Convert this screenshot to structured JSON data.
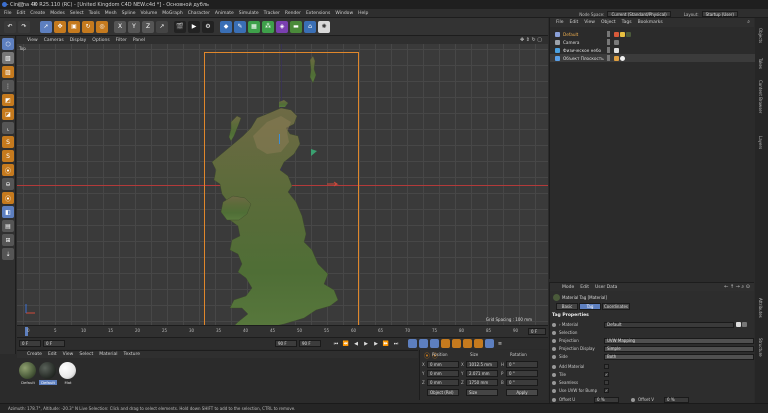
{
  "window": {
    "title": "Cinema 4D R25.110 (RC) - [United Kingdom C4D NEW.c4d *] - Основной дубль",
    "controls": [
      "–",
      "□",
      "✕"
    ]
  },
  "menubar": {
    "items": [
      "File",
      "Edit",
      "Create",
      "Modes",
      "Select",
      "Tools",
      "Mesh",
      "Spline",
      "Volume",
      "MoGraph",
      "Character",
      "Animate",
      "Simulate",
      "Tracker",
      "Render",
      "Extensions",
      "Window",
      "Help"
    ],
    "node_space_label": "Node Space:",
    "node_space_value": "Current (Standard/Physical)",
    "layout_label": "Layout:",
    "layout_value": "Startup (User)"
  },
  "viewport": {
    "menu": [
      "View",
      "Cameras",
      "Display",
      "Options",
      "Filter",
      "Panel"
    ],
    "label": "Top",
    "grid_spacing": "Grid Spacing : 100 mm",
    "colors": {
      "plane_border": "#e0872b",
      "x_axis": "#b33a3a"
    }
  },
  "timeline": {
    "ticks": [
      "0",
      "5",
      "10",
      "15",
      "20",
      "25",
      "30",
      "35",
      "40",
      "45",
      "50",
      "55",
      "60",
      "65",
      "70",
      "75",
      "80",
      "85",
      "90"
    ],
    "current_frame": "0 F",
    "start_field": "0 F",
    "start_field2": "0 F",
    "end_field": "90 F",
    "end_field2": "90 F"
  },
  "material_manager": {
    "menu": [
      "Create",
      "Edit",
      "View",
      "Select",
      "Material",
      "Texture"
    ],
    "materials": [
      {
        "label": "Default",
        "color": "#4a5a3a"
      },
      {
        "label": "Default",
        "color": "#2a2f2a",
        "selected": true
      },
      {
        "label": "Mat",
        "color": "#e9e9e9"
      }
    ]
  },
  "coordinates": {
    "headers": {
      "position": "Position",
      "size": "Size",
      "rotation": "Rotation"
    },
    "rows": [
      {
        "axis": "X",
        "pos": "0 mm",
        "size": "1012.5 mm",
        "rot_axis": "H",
        "rot": "0 °"
      },
      {
        "axis": "Y",
        "pos": "0 mm",
        "size": "2.071 mm",
        "rot_axis": "P",
        "rot": "0 °"
      },
      {
        "axis": "Z",
        "pos": "0 mm",
        "size": "1750 mm",
        "rot_axis": "B",
        "rot": "0 °"
      }
    ],
    "mode_dropdown": "Object (Rel)",
    "size_dropdown": "Size",
    "apply_label": "Apply"
  },
  "object_manager": {
    "menu": [
      "File",
      "Edit",
      "View",
      "Object",
      "Tags",
      "Bookmarks"
    ],
    "objects": [
      {
        "name": "Default",
        "icon_color": "#8aa0d8",
        "tag_colors": [
          "#d85a3a",
          "#e8c040",
          "#4a5a3a"
        ]
      },
      {
        "name": "Camera",
        "icon_color": "#9aa0a8",
        "tag_colors": [
          "#7a7a7a"
        ]
      },
      {
        "name": "Физическое небо",
        "icon_color": "#4aa0e0",
        "tag_colors": [
          "#e0e0e0"
        ]
      },
      {
        "name": "Объект Плоскость",
        "icon_color": "#5aa0e8",
        "tag_colors": [
          "#e0a040",
          "#f0f0f0"
        ]
      }
    ]
  },
  "attribute_manager": {
    "menu": [
      "Mode",
      "Edit",
      "User Data"
    ],
    "tag_title": "Material Tag [Material]",
    "tabs": [
      "Basic",
      "Tag",
      "Coordinates"
    ],
    "section": "Tag Properties",
    "rows": [
      {
        "label": "› Material",
        "value": "Default"
      },
      {
        "label": "Selection",
        "value": ""
      },
      {
        "label": "Projection",
        "value": "UVW Mapping"
      },
      {
        "label": "Projection Display",
        "value": "Simple"
      },
      {
        "label": "Side",
        "value": "Both"
      },
      {
        "label": "Add Material",
        "value": "",
        "checkbox": true,
        "checked": false
      },
      {
        "label": "Tile",
        "value": "",
        "checkbox": true,
        "checked": true
      },
      {
        "label": "Seamless",
        "value": "",
        "checkbox": true,
        "checked": false
      },
      {
        "label": "Use UVW for Bump",
        "value": "",
        "checkbox": true,
        "checked": true
      }
    ],
    "offset_u_label": "Offset U",
    "offset_u": "0 %",
    "offset_v_label": "Offset V",
    "offset_v": "0 %"
  },
  "right_tabs": [
    "Objects",
    "Takes",
    "Content Browser",
    "Layers",
    "Attributes",
    "Structure"
  ],
  "status": {
    "text": "Azimuth: 178.7°, Altitude: -20.3° N    Live Selection: Click and drag to select elements. Hold down SHIFT to add to the selection, CTRL to remove."
  }
}
